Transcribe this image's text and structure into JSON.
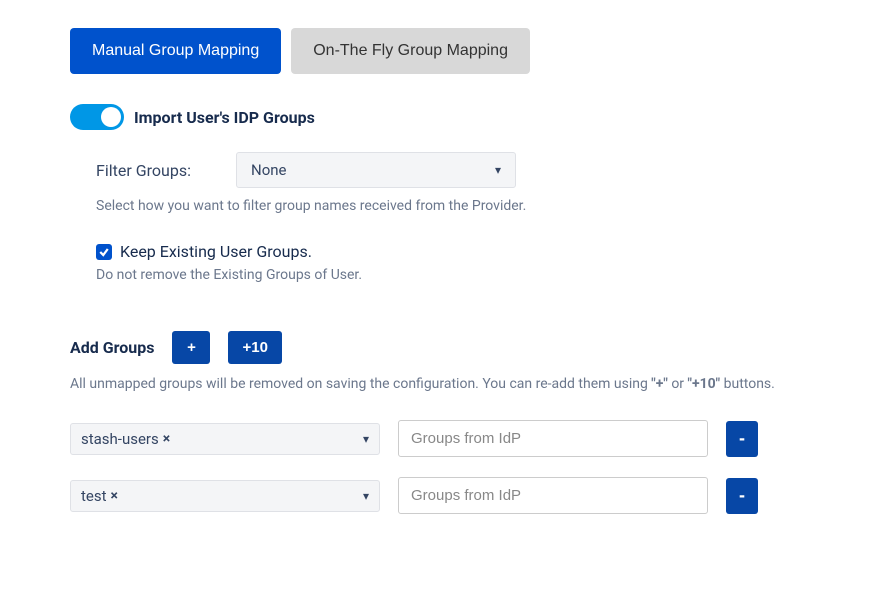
{
  "tabs": {
    "manual": "Manual Group Mapping",
    "fly": "On-The Fly Group Mapping"
  },
  "import_toggle_label": "Import User's IDP Groups",
  "filter": {
    "label": "Filter Groups:",
    "value": "None",
    "helper": "Select how you want to filter group names received from the Provider."
  },
  "keep_existing": {
    "label": "Keep Existing User Groups.",
    "helper": "Do not remove the Existing Groups of User."
  },
  "add_groups": {
    "label": "Add Groups",
    "plus": "+",
    "plus10": "+10",
    "info_pre": "All unmapped groups will be removed on saving the configuration. You can re-add them using ",
    "q1": "\"+\"",
    "info_or": " or ",
    "q2": "\"+10\"",
    "info_post": " buttons."
  },
  "rows": [
    {
      "local": "stash-users",
      "idp_placeholder": "Groups from IdP"
    },
    {
      "local": "test",
      "idp_placeholder": "Groups from IdP"
    }
  ],
  "icons": {
    "x": "×",
    "minus": "-",
    "chev": "▾"
  }
}
